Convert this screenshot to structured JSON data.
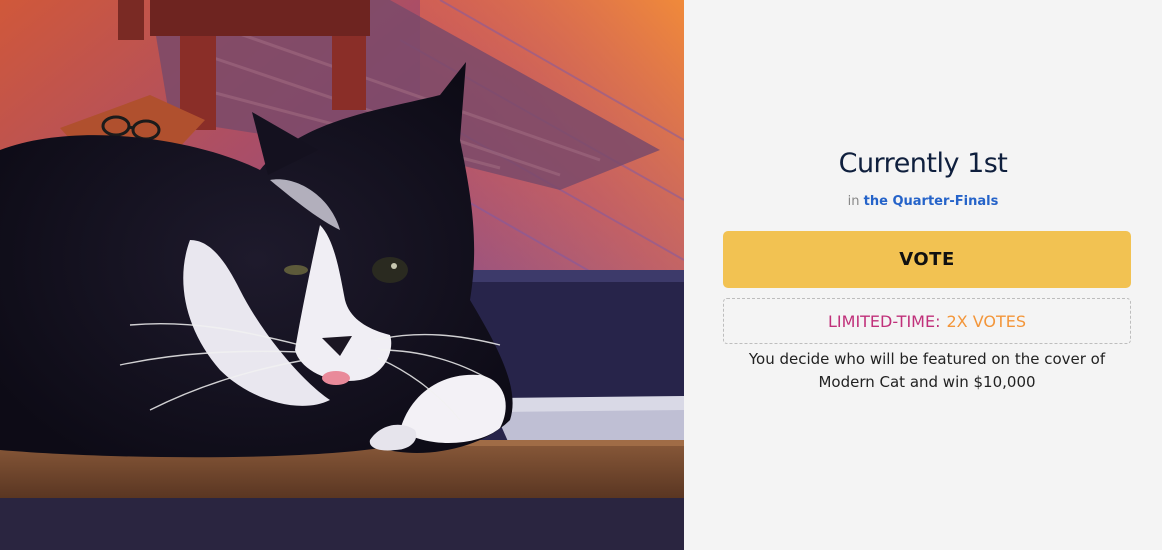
{
  "photo": {
    "subject": "cat-photo"
  },
  "status": {
    "title": "Currently 1st",
    "in_text": "in",
    "round_link": "the Quarter-Finals"
  },
  "vote": {
    "label": "VOTE"
  },
  "promo": {
    "label": "LIMITED-TIME:",
    "value": "2X VOTES"
  },
  "description": "You decide who will be featured on the cover of Modern Cat and win $10,000",
  "colors": {
    "vote_button": "#f2c252",
    "promo_label": "#c0307a",
    "promo_value": "#f3963a",
    "link": "#2563c9",
    "title": "#0f1f3d",
    "panel_bg": "#f4f4f4"
  }
}
